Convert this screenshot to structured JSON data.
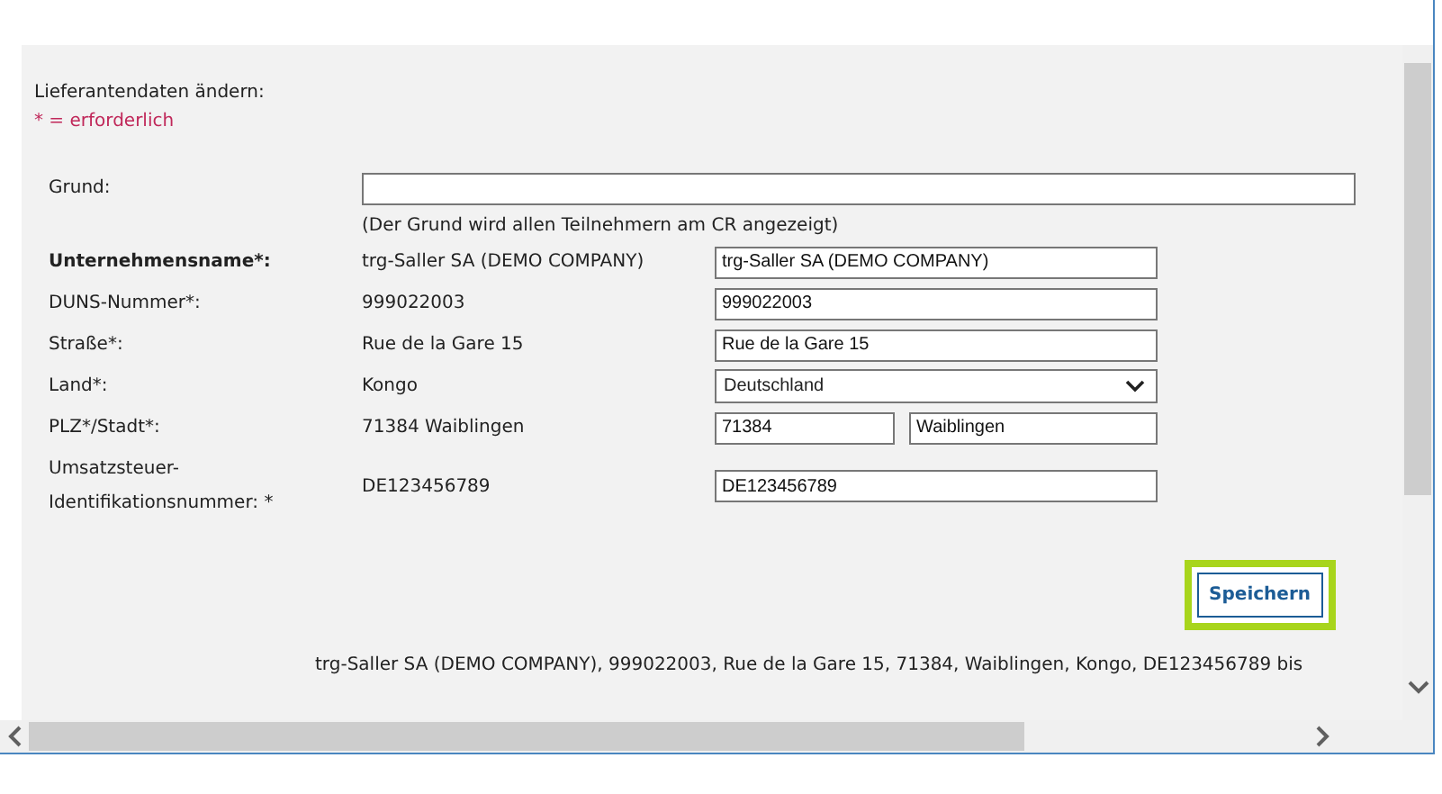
{
  "form": {
    "title": "Lieferantendaten ändern:",
    "required_note": "* = erforderlich",
    "reason": {
      "label": "Grund:",
      "hint": "(Der Grund wird allen Teilnehmern am CR angezeigt)"
    },
    "fields": [
      {
        "kind": "text",
        "label": "Unternehmensname*:",
        "bold": true,
        "current": "trg-Saller SA (DEMO COMPANY)",
        "values": [
          "trg-Saller SA (DEMO COMPANY)"
        ]
      },
      {
        "kind": "text",
        "label": "DUNS-Nummer*:",
        "bold": false,
        "current": "999022003",
        "values": [
          "999022003"
        ]
      },
      {
        "kind": "text",
        "label": "Straße*:",
        "bold": false,
        "current": "Rue de la Gare 15",
        "values": [
          "Rue de la Gare 15"
        ]
      },
      {
        "kind": "select",
        "label": "Land*:",
        "bold": false,
        "current": "Kongo",
        "values": [
          "Deutschland"
        ]
      },
      {
        "kind": "pair",
        "label": "PLZ*/Stadt*:",
        "bold": false,
        "current": "71384 Waiblingen",
        "values": [
          "71384",
          "Waiblingen"
        ]
      },
      {
        "kind": "text",
        "label": "Umsatzsteuer-\nIdentifikationsnummer: *",
        "bold": false,
        "current": "DE123456789",
        "values": [
          "DE123456789"
        ]
      }
    ],
    "save_button": {
      "label": "Speichern",
      "focused": true
    },
    "history": "trg-Saller SA (DEMO COMPANY), 999022003, Rue de la Gare 15, 71384, Waiblingen, Kongo, DE123456789 bis"
  }
}
